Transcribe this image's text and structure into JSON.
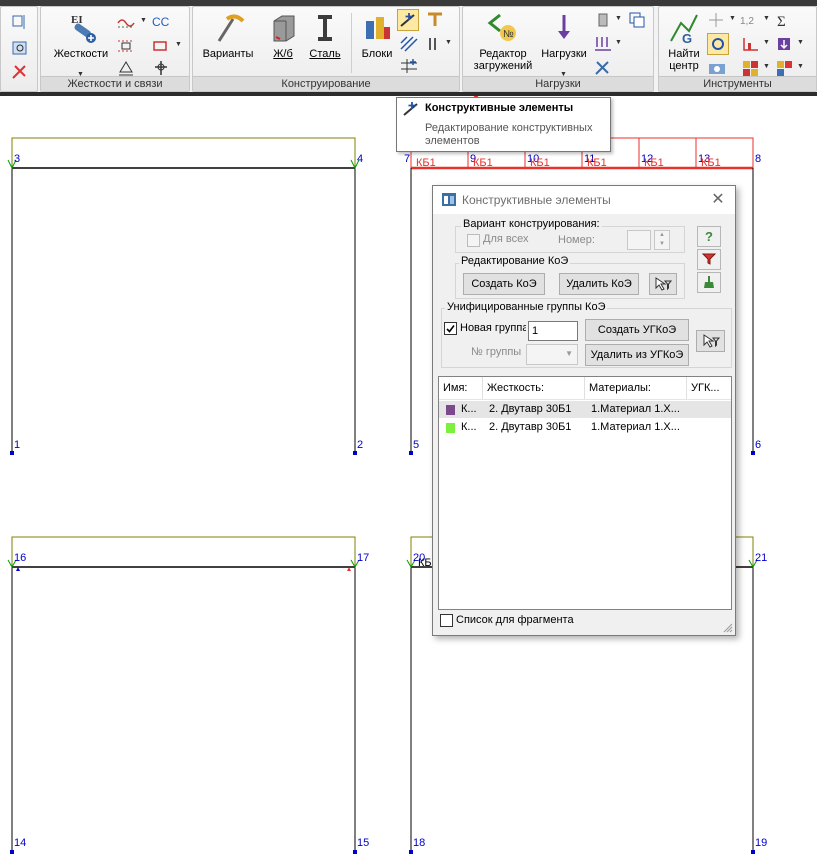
{
  "ribbon": {
    "groups": [
      {
        "label": "Жесткости и связи"
      },
      {
        "label": "Конструирование"
      },
      {
        "label": "Нагрузки"
      },
      {
        "label": "Инструменты"
      }
    ],
    "buttons": {
      "stiffness": "Жесткости",
      "variants": "Варианты",
      "rc": "Ж/б",
      "steel": "Сталь",
      "blocks": "Блоки",
      "load_editor_1": "Редактор",
      "load_editor_2": "загружений",
      "loads": "Нагрузки",
      "find_center_1": "Найти",
      "find_center_2": "центр"
    },
    "small_texts": {
      "ei": "EI",
      "cc": "CC",
      "sigma": "Σ",
      "one_two": "1,2",
      "g": "G"
    }
  },
  "tooltip": {
    "title": "Конструктивные элементы",
    "description": "Редактирование конструктивных элементов"
  },
  "frames": {
    "f1": {
      "top_left": "3",
      "top_right": "4",
      "bot_left": "1",
      "bot_right": "2"
    },
    "f2": {
      "top_left": "7",
      "top_right": "8",
      "bot_left": "5",
      "bot_right": "6",
      "mid_nodes": [
        "9",
        "10",
        "11",
        "12",
        "13"
      ],
      "element_label": "КБ1"
    },
    "f3": {
      "top_left": "16",
      "top_right": "17",
      "bot_left": "14",
      "bot_right": "15"
    },
    "f4": {
      "top_left": "20",
      "top_right": "21",
      "bot_left": "18",
      "bot_right": "19",
      "element_label": "КБ"
    }
  },
  "dialog": {
    "title": "Конструктивные элементы",
    "variant_group": "Вариант конструирования:",
    "for_all": "Для всех",
    "number_label": "Номер:",
    "edit_group": "Редактирование КоЭ",
    "create_koe": "Создать КоЭ",
    "delete_koe": "Удалить КоЭ",
    "unified_group": "Унифицированные группы КоЭ",
    "new_group": "Новая группа",
    "new_group_value": "1",
    "create_ugkoe": "Создать УГКоЭ",
    "group_no": "№ группы",
    "delete_from_ugkoe": "Удалить из УГКоЭ",
    "columns": [
      "Имя:",
      "Жесткость:",
      "Материалы:",
      "УГК..."
    ],
    "rows": [
      {
        "name": "К...",
        "stiffness": "2. Двутавр 30Б1",
        "material": "1.Материал 1.Х...",
        "ugk": "",
        "color": "#7b4a8c"
      },
      {
        "name": "К...",
        "stiffness": "2. Двутавр 30Б1",
        "material": "1.Материал 1.Х...",
        "ugk": "",
        "color": "#7cf03a"
      }
    ],
    "fragment_list": "Список для фрагмента"
  },
  "colors": {
    "accent_red": "#e8322c",
    "node_blue": "#0000cc",
    "frame_olive": "#808000",
    "support_green": "#00a000"
  }
}
